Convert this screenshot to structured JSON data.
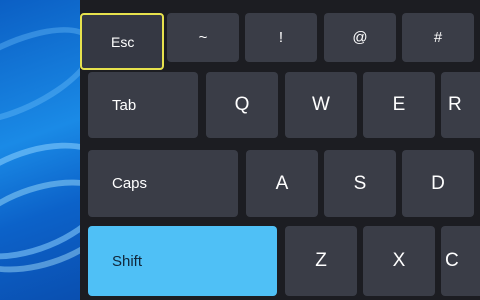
{
  "keyboard": {
    "row1": {
      "esc": "Esc",
      "tilde": "~",
      "exclaim": "!",
      "at": "@",
      "hash": "#"
    },
    "row2": {
      "tab": "Tab",
      "q": "Q",
      "w": "W",
      "e": "E",
      "r": "R"
    },
    "row3": {
      "caps": "Caps",
      "a": "A",
      "s": "S",
      "d": "D"
    },
    "row4": {
      "shift": "Shift",
      "z": "Z",
      "x": "X",
      "c": "C"
    }
  },
  "colors": {
    "keyboard_bg": "#1c1d22",
    "key_bg": "#3a3d47",
    "focus_outline": "#e7e24d",
    "shift_active": "#4fc0f6"
  }
}
